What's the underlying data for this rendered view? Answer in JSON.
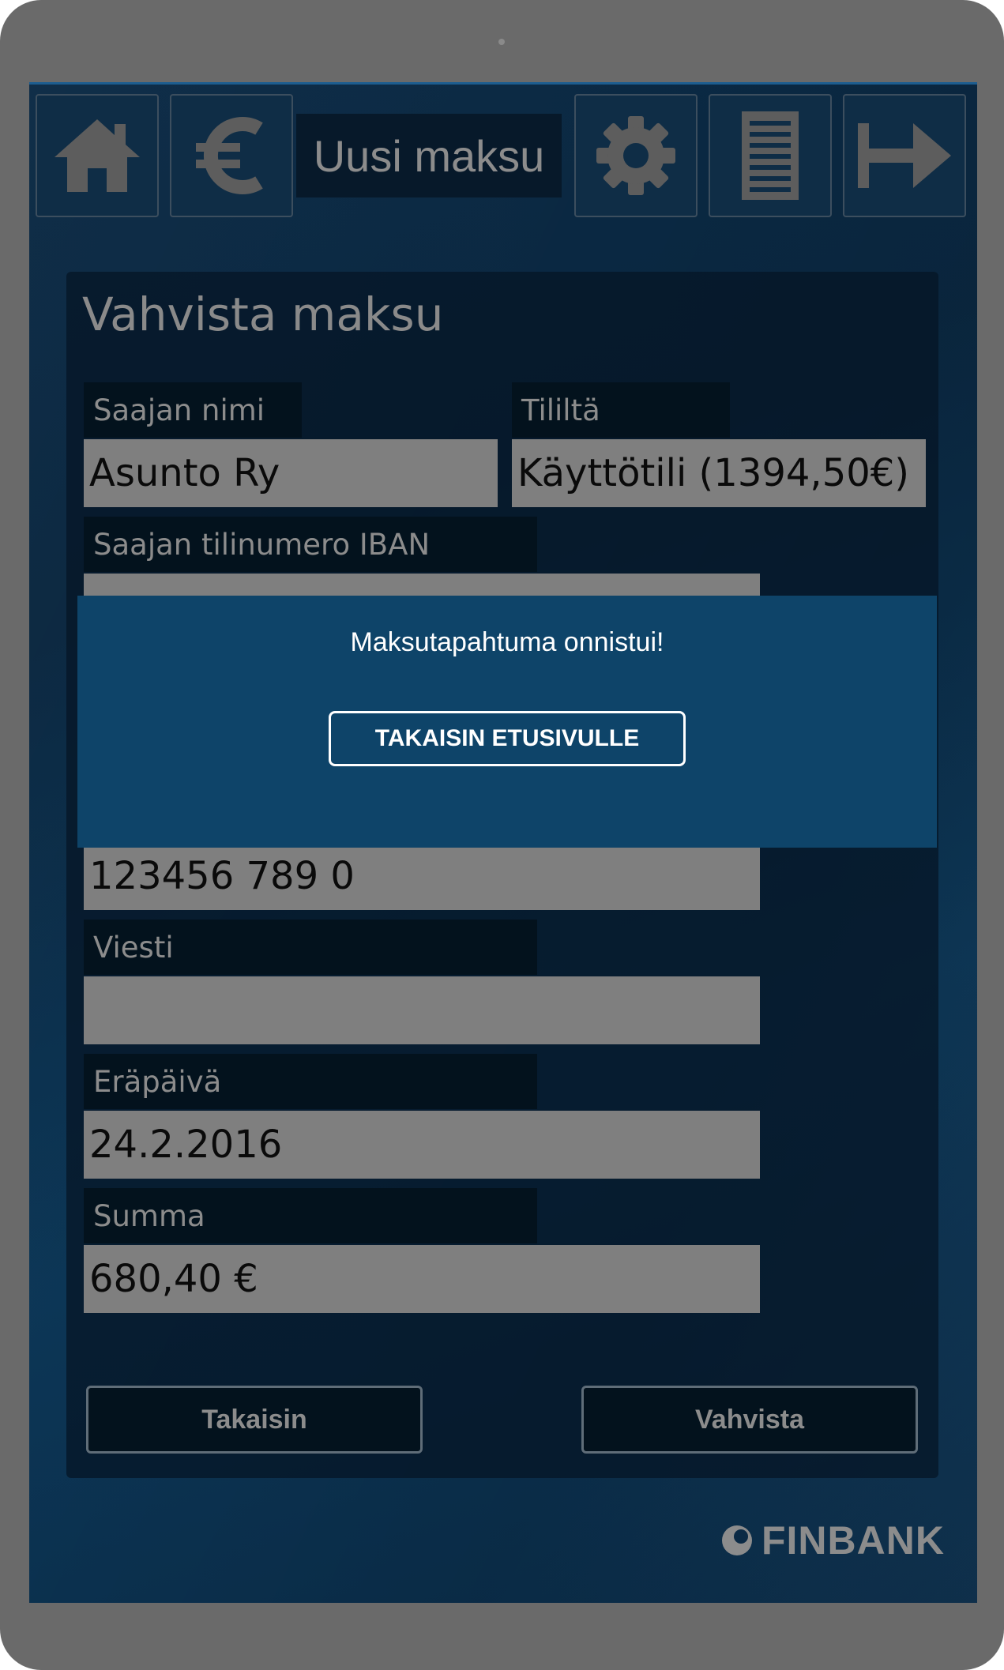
{
  "header": {
    "title": "Uusi maksu",
    "icons": [
      "home-icon",
      "euro-icon",
      "gear-icon",
      "document-icon",
      "logout-arrow-icon"
    ]
  },
  "form": {
    "title": "Vahvista maksu",
    "recipient_name_label": "Saajan nimi",
    "recipient_name_value": "Asunto Ry",
    "from_account_label": "Tililtä",
    "from_account_value": "Käyttötili (1394,50€)",
    "iban_label": "Saajan tilinumero IBAN",
    "iban_value": "",
    "reference_value": "123456 789 0",
    "message_label": "Viesti",
    "message_value": "",
    "due_date_label": "Eräpäivä",
    "due_date_value": "24.2.2016",
    "amount_label": "Summa",
    "amount_value": "680,40 €",
    "back_button": "Takaisin",
    "confirm_button": "Vahvista"
  },
  "modal": {
    "message": "Maksutapahtuma onnistui!",
    "button": "TAKAISIN ETUSIVULLE"
  },
  "brand": {
    "name": "FINBANK"
  },
  "colors": {
    "screen_bg": "#0b2a45",
    "modal_bg": "#0e4469",
    "field_bg": "#7f7f7f",
    "label_bg": "#03121d"
  }
}
